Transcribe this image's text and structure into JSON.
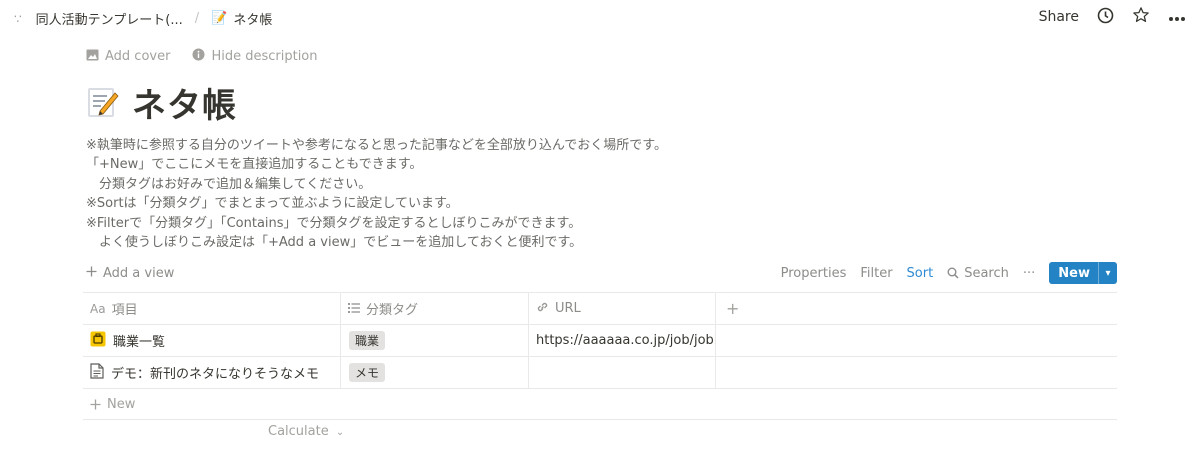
{
  "breadcrumb": {
    "parent": "同人活動テンプレート(...",
    "separator": "/",
    "current": "ネタ帳",
    "current_icon": "memo-emoji"
  },
  "topbar": {
    "share_label": "Share",
    "history_icon": "clock-icon",
    "favorite_icon": "star-icon",
    "more_icon": "ellipsis-icon"
  },
  "page_actions": {
    "add_cover": "Add cover",
    "hide_description": "Hide description"
  },
  "page": {
    "icon": "memo-emoji",
    "title": "ネタ帳",
    "description": [
      "※執筆時に参照する自分のツイートや参考になると思った記事などを全部放り込んでおく場所です。",
      "「+New」でここにメモを直接追加することもできます。",
      "　分類タグはお好みで追加＆編集してください。",
      "※Sortは「分類タグ」でまとまって並ぶように設定しています。",
      "※Filterで「分類タグ」「Contains」で分類タグを設定するとしぼりこみができます。",
      "　よく使うしぼりこみ設定は「+Add a view」でビューを追加しておくと便利です。"
    ]
  },
  "toolbar": {
    "add_view": "Add a view",
    "properties": "Properties",
    "filter": "Filter",
    "sort": "Sort",
    "search": "Search",
    "more": "···",
    "new": "New"
  },
  "table": {
    "columns": [
      {
        "icon": "Aa",
        "label": "項目"
      },
      {
        "icon": "list-icon",
        "label": "分類タグ"
      },
      {
        "icon": "link-icon",
        "label": "URL"
      },
      {
        "icon": "plus-icon",
        "label": "+"
      }
    ],
    "rows": [
      {
        "icon": "briefcase-emoji",
        "title": "職業一覧",
        "tag": "職業",
        "url": "https://aaaaaa.co.jp/job/joblist/"
      },
      {
        "icon": "page-icon",
        "title": "デモ：新刊のネタになりそうなメモ",
        "tag": "メモ",
        "url": ""
      }
    ],
    "new_row": "New",
    "calculate": "Calculate"
  },
  "colors": {
    "accent": "#2383c5",
    "sort_active": "#2e8bd4",
    "tag_bg": "#e3e2e0",
    "text": "#37352f",
    "muted": "#a3a29e"
  }
}
